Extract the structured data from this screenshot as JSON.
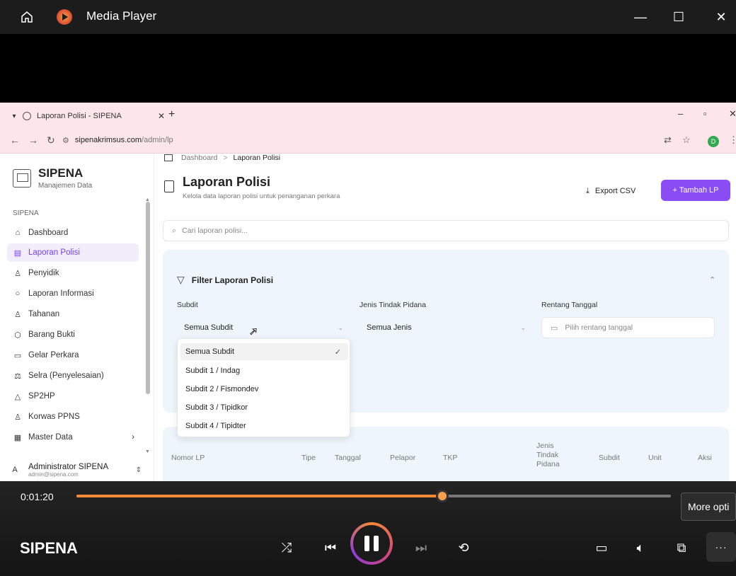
{
  "player": {
    "title": "Media Player",
    "track_title": "SIPENA",
    "time_elapsed": "0:01:20",
    "progress_fraction": 0.615,
    "tooltip": "More opti",
    "more_label": "···",
    "accent": "#f58a35"
  },
  "browser": {
    "tab_title": "Laporan Polisi - SIPENA",
    "url_host": "sipenakrimsus.com",
    "url_path": "/admin/lp",
    "profile_initial": "D"
  },
  "app": {
    "brand_name": "SIPENA",
    "brand_sub": "Manajemen Data",
    "section_label": "SIPENA",
    "sidebar_items": [
      {
        "label": "Dashboard",
        "icon": "home-icon"
      },
      {
        "label": "Laporan Polisi",
        "icon": "document-icon"
      },
      {
        "label": "Penyidik",
        "icon": "user-icon"
      },
      {
        "label": "Laporan Informasi",
        "icon": "circle-icon"
      },
      {
        "label": "Tahanan",
        "icon": "user-x-icon"
      },
      {
        "label": "Barang Bukti",
        "icon": "package-icon"
      },
      {
        "label": "Gelar Perkara",
        "icon": "presentation-icon"
      },
      {
        "label": "Selra (Penyelesaian)",
        "icon": "scale-icon"
      },
      {
        "label": "SP2HP",
        "icon": "bell-icon"
      },
      {
        "label": "Korwas PPNS",
        "icon": "users-icon"
      },
      {
        "label": "Master Data",
        "icon": "database-icon"
      }
    ],
    "active_item": "Laporan Polisi",
    "user_initial": "A",
    "user_name": "Administrator SIPENA",
    "user_email": "admin@sipena.com",
    "accent": "#8a4cf5"
  },
  "breadcrumb": {
    "home": "Dashboard",
    "separator": ">",
    "current": "Laporan Polisi"
  },
  "page": {
    "title": "Laporan Polisi",
    "subtitle": "Kelola data laporan polisi untuk penanganan perkara",
    "export_label": "Export CSV",
    "add_label": "+ Tambah LP",
    "search_placeholder": "Cari laporan polisi..."
  },
  "filter": {
    "title": "Filter Laporan Polisi",
    "subdit_label": "Subdit",
    "subdit_value": "Semua Subdit",
    "jenis_label": "Jenis Tindak Pidana",
    "jenis_value": "Semua Jenis",
    "tanggal_label": "Rentang Tanggal",
    "tanggal_placeholder": "Pilih rentang tanggal",
    "subdit_options": [
      "Semua Subdit",
      "Subdit 1 / Indag",
      "Subdit 2 / Fismondev",
      "Subdit 3 / Tipidkor",
      "Subdit 4 / Tipidter"
    ],
    "selected_option": "Semua Subdit"
  },
  "table": {
    "columns": [
      "Nomor LP",
      "Tipe",
      "Tanggal",
      "Pelapor",
      "TKP",
      "Jenis Tindak Pidana",
      "Subdit",
      "Unit",
      "Aksi"
    ]
  }
}
